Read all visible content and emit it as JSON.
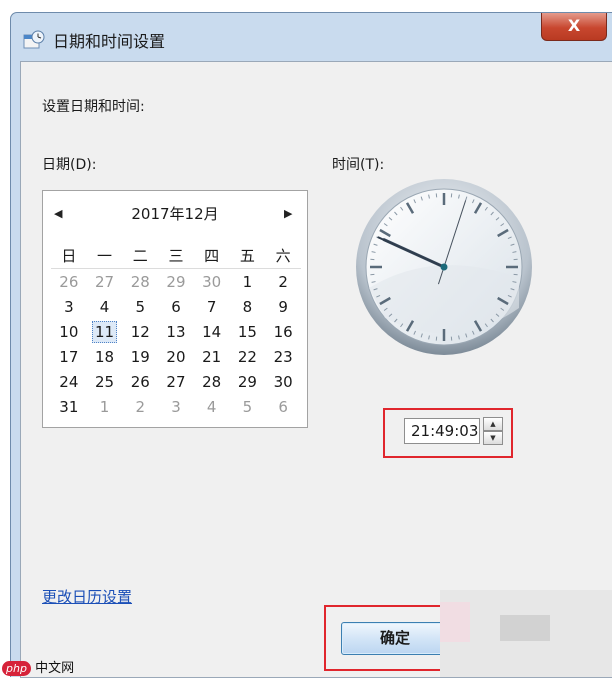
{
  "window": {
    "title": "日期和时间设置",
    "close_label": "X"
  },
  "labels": {
    "heading": "设置日期和时间:",
    "date_label": "日期(D):",
    "time_label": "时间(T):"
  },
  "calendar": {
    "month_title": "2017年12月",
    "prev_glyph": "◀",
    "next_glyph": "▶",
    "weekdays": [
      "日",
      "一",
      "二",
      "三",
      "四",
      "五",
      "六"
    ],
    "weeks": [
      [
        "26",
        "27",
        "28",
        "29",
        "30",
        "1",
        "2"
      ],
      [
        "3",
        "4",
        "5",
        "6",
        "7",
        "8",
        "9"
      ],
      [
        "10",
        "11",
        "12",
        "13",
        "14",
        "15",
        "16"
      ],
      [
        "17",
        "18",
        "19",
        "20",
        "21",
        "22",
        "23"
      ],
      [
        "24",
        "25",
        "26",
        "27",
        "28",
        "29",
        "30"
      ],
      [
        "31",
        "1",
        "2",
        "3",
        "4",
        "5",
        "6"
      ]
    ],
    "selected_day": "11"
  },
  "clock": {
    "hours": 21,
    "minutes": 49,
    "seconds": 3
  },
  "time_input": {
    "value": "21:49:03"
  },
  "link": {
    "label": "更改日历设置"
  },
  "buttons": {
    "ok_label": "确定"
  },
  "watermark": {
    "logo": "php",
    "text": "中文网"
  },
  "colors": {
    "frame": "#c9dbee",
    "client": "#f0f0f0",
    "highlight_red": "#e0262d",
    "link_blue": "#1b4fb7",
    "close_red": "#c8472f"
  }
}
